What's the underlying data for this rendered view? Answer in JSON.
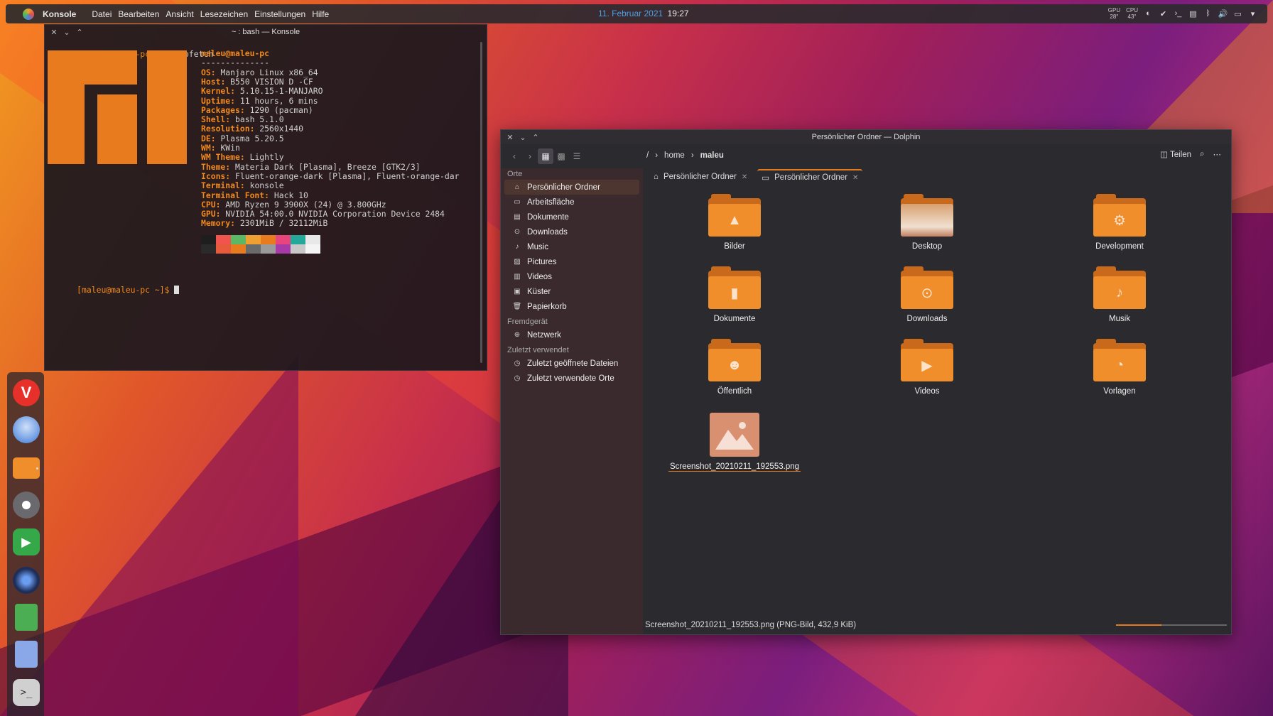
{
  "top_panel": {
    "app_name": "Konsole",
    "menu": [
      "Datei",
      "Bearbeiten",
      "Ansicht",
      "Lesezeichen",
      "Einstellungen",
      "Hilfe"
    ],
    "date": "11. Februar 2021",
    "time": "19:27",
    "gpu_label": "GPU",
    "gpu_temp": "28°",
    "cpu_label": "CPU",
    "cpu_temp": "43°"
  },
  "konsole": {
    "title": "~ : bash — Konsole",
    "prompt": "[maleu@maleu-pc ~]$",
    "command": "neofetch",
    "user_host": "maleu@maleu-pc",
    "separator": "--------------",
    "info": [
      {
        "key": "OS",
        "value": "Manjaro Linux x86_64"
      },
      {
        "key": "Host",
        "value": "B550 VISION D -CF"
      },
      {
        "key": "Kernel",
        "value": "5.10.15-1-MANJARO"
      },
      {
        "key": "Uptime",
        "value": "11 hours, 6 mins"
      },
      {
        "key": "Packages",
        "value": "1290 (pacman)"
      },
      {
        "key": "Shell",
        "value": "bash 5.1.0"
      },
      {
        "key": "Resolution",
        "value": "2560x1440"
      },
      {
        "key": "DE",
        "value": "Plasma 5.20.5"
      },
      {
        "key": "WM",
        "value": "KWin"
      },
      {
        "key": "WM Theme",
        "value": "Lightly"
      },
      {
        "key": "Theme",
        "value": "Materia Dark [Plasma], Breeze [GTK2/3]"
      },
      {
        "key": "Icons",
        "value": "Fluent-orange-dark [Plasma], Fluent-orange-dar"
      },
      {
        "key": "Terminal",
        "value": "konsole"
      },
      {
        "key": "Terminal Font",
        "value": "Hack 10"
      },
      {
        "key": "CPU",
        "value": "AMD Ryzen 9 3900X (24) @ 3.800GHz"
      },
      {
        "key": "GPU",
        "value": "NVIDIA 54:00.0 NVIDIA Corporation Device 2484"
      },
      {
        "key": "Memory",
        "value": "2301MiB / 32112MiB"
      }
    ],
    "colors_top": [
      "#1e1e1e",
      "#f0544c",
      "#5bb864",
      "#f0a030",
      "#e97b1f",
      "#e8457c",
      "#23a89a",
      "#e8e8e8"
    ],
    "colors_bottom": [
      "#2a2a2a",
      "#e85a3c",
      "#e97b1f",
      "#6a6a6a",
      "#9a9a9a",
      "#a83aa8",
      "#c8c8c8",
      "#f4f4f4"
    ]
  },
  "dock": [
    "vivaldi-icon",
    "thunderbird-icon",
    "folder-icon",
    "settings-icon",
    "media-player-icon",
    "steam-icon",
    "spreadsheet-icon",
    "document-icon",
    "terminal-icon"
  ],
  "dolphin": {
    "title": "Persönlicher Ordner — Dolphin",
    "breadcrumb": [
      "/",
      "home",
      "maleu"
    ],
    "share_label": "Teilen",
    "places_title": "Orte",
    "places": [
      "Persönlicher Ordner",
      "Arbeitsfläche",
      "Dokumente",
      "Downloads",
      "Music",
      "Pictures",
      "Videos",
      "Küster",
      "Papierkorb"
    ],
    "remote_title": "Fremdgerät",
    "remote": [
      "Netzwerk"
    ],
    "recent_title": "Zuletzt verwendet",
    "recent": [
      "Zuletzt geöffnete Dateien",
      "Zuletzt verwendete Orte"
    ],
    "tabs": [
      "Persönlicher Ordner",
      "Persönlicher Ordner"
    ],
    "files": [
      "Bilder",
      "Desktop",
      "Development",
      "Dokumente",
      "Downloads",
      "Musik",
      "Öffentlich",
      "Videos",
      "Vorlagen",
      "Screenshot_20210211_192553.png"
    ],
    "status": "Screenshot_20210211_192553.png (PNG-Bild, 432,9 KiB)"
  }
}
